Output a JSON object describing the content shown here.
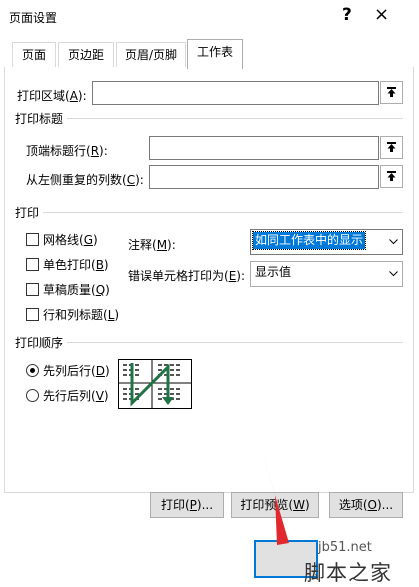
{
  "window": {
    "title": "页面设置",
    "help": "?",
    "close": "×"
  },
  "tabs": [
    "页面",
    "页边距",
    "页眉/页脚",
    "工作表"
  ],
  "print_area": {
    "label": "打印区域(",
    "key": "A",
    "tail": "):",
    "value": ""
  },
  "print_titles": {
    "group": "打印标题",
    "rows": {
      "label": "顶端标题行(",
      "key": "R",
      "tail": "):",
      "value": ""
    },
    "cols": {
      "label": "从左侧重复的列数(",
      "key": "C",
      "tail": "):",
      "value": ""
    }
  },
  "print": {
    "group": "打印",
    "gridlines": {
      "label": "网格线(",
      "key": "G",
      "tail": ")",
      "checked": false
    },
    "bw": {
      "label": "单色打印(",
      "key": "B",
      "tail": ")",
      "checked": false
    },
    "draft": {
      "label": "草稿质量(",
      "key": "Q",
      "tail": ")",
      "checked": false
    },
    "headings": {
      "label": "行和列标题(",
      "key": "L",
      "tail": ")",
      "checked": false
    },
    "comments": {
      "label": "注释(",
      "key": "M",
      "tail": "):",
      "value": "如同工作表中的显示"
    },
    "errors": {
      "label": "错误单元格打印为(",
      "key": "E",
      "tail": "):",
      "value": "显示值"
    }
  },
  "order": {
    "group": "打印顺序",
    "down_over": {
      "label": "先列后行(",
      "key": "D",
      "tail": ")",
      "selected": true
    },
    "over_down": {
      "label": "先行后列(",
      "key": "V",
      "tail": ")",
      "selected": false
    }
  },
  "buttons": {
    "print": {
      "label": "打印(",
      "key": "P",
      "tail": ")..."
    },
    "preview": {
      "label": "打印预览(",
      "key": "W",
      "tail": ")"
    },
    "options": {
      "label": "选项(",
      "key": "O",
      "tail": ")..."
    }
  },
  "watermark": {
    "site": "jb51.net",
    "name": "脚本之家"
  },
  "colors": {
    "highlight": "#0078d7",
    "arrow": "#e0282e",
    "order_arrow": "#217346"
  }
}
